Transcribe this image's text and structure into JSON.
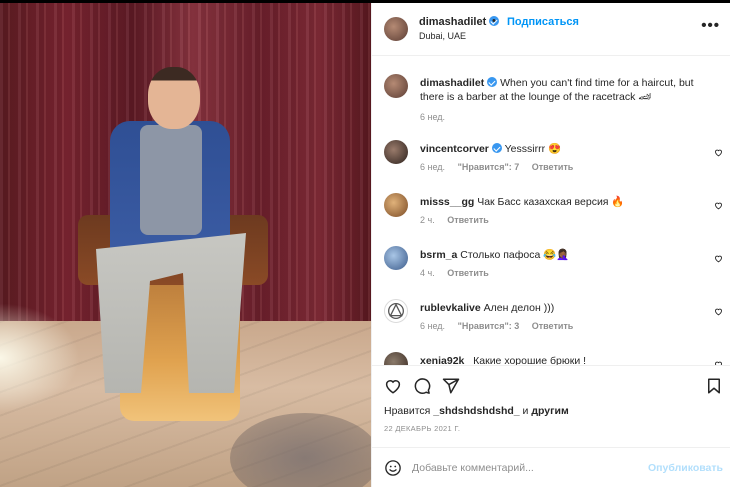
{
  "post": {
    "photo_alt": "Man in sunglasses sitting in a barber chair taking a mirror selfie",
    "header": {
      "username": "dimashadilet",
      "separator": "•",
      "follow_label": "Подписаться",
      "location": "Dubai, UAE",
      "more_icon": "more-horizontal-icon"
    },
    "caption": {
      "username": "dimashadilet",
      "text": "When you can't find time for a haircut, but there is a barber at the lounge of the racetrack 🏎",
      "time": "6 нед."
    },
    "comments": [
      {
        "username": "vincentcorver",
        "verified": true,
        "text": "Yesssirrr 😍",
        "time": "6 нед.",
        "likes": "\"Нравится\": 7",
        "reply": "Ответить"
      },
      {
        "username": "misss__gg",
        "verified": false,
        "text": "Чак Басс казахская версия 🔥",
        "time": "2 ч.",
        "likes": "",
        "reply": "Ответить"
      },
      {
        "username": "bsrm_a",
        "verified": false,
        "text": "Столько пафоса 😂🤦🏾‍♀️",
        "time": "4 ч.",
        "likes": "",
        "reply": "Ответить"
      },
      {
        "username": "rublevkalive",
        "verified": false,
        "text": "Ален делон )))",
        "time": "6 нед.",
        "likes": "\"Нравится\": 3",
        "reply": "Ответить"
      },
      {
        "username": "xenia92k_",
        "verified": false,
        "text": "Какие хорошие брюки !",
        "time": "",
        "likes": "",
        "reply": ""
      }
    ],
    "likes_line": {
      "prefix": "Нравится",
      "user": "_shdshdshdshd_",
      "conj": "и",
      "others": "другим"
    },
    "date": "22 ДЕКАБРЬ 2021 Г.",
    "add_comment": {
      "placeholder": "Добавьте комментарий...",
      "publish_label": "Опубликовать"
    }
  },
  "colors": {
    "accent": "#0095f6",
    "verified": "#3897f0",
    "muted": "#8e8e8e",
    "publish_disabled": "#b2dffc"
  }
}
